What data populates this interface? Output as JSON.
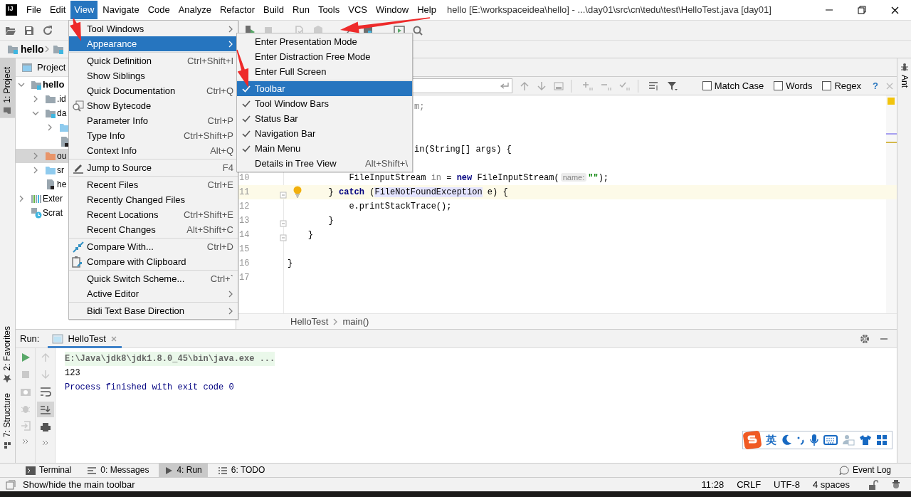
{
  "window": {
    "logo": "IJ",
    "title": "hello [E:\\workspaceidea\\hello] - ...\\day01\\src\\cn\\tedu\\test\\HelloTest.java [day01]"
  },
  "menu_bar": [
    {
      "label": "File",
      "selected": false
    },
    {
      "label": "Edit",
      "selected": false
    },
    {
      "label": "View",
      "selected": true
    },
    {
      "label": "Navigate",
      "selected": false
    },
    {
      "label": "Code",
      "selected": false
    },
    {
      "label": "Analyze",
      "selected": false
    },
    {
      "label": "Refactor",
      "selected": false
    },
    {
      "label": "Build",
      "selected": false
    },
    {
      "label": "Run",
      "selected": false
    },
    {
      "label": "Tools",
      "selected": false
    },
    {
      "label": "VCS",
      "selected": false
    },
    {
      "label": "Window",
      "selected": false
    },
    {
      "label": "Help",
      "selected": false
    }
  ],
  "navigation_bar": [
    {
      "label": "hello",
      "kind": "module"
    },
    {
      "kind": "module"
    }
  ],
  "left_tool_tabs": [
    {
      "label": "1: Project",
      "selected": true,
      "kind": "project"
    },
    {
      "label": "2: Favorites",
      "selected": false,
      "kind": "favorites"
    },
    {
      "label": "7: Structure",
      "selected": false,
      "kind": "structure"
    }
  ],
  "right_tool_tabs": [
    {
      "label": "Ant",
      "selected": false
    }
  ],
  "project_panel": {
    "title": "Project",
    "tree": [
      {
        "label": "hello",
        "kind": "module",
        "expanded": true,
        "selected": false,
        "children": [
          {
            "label": ".id",
            "kind": "folder",
            "expanded": false,
            "selected": false
          },
          {
            "label": "da",
            "kind": "module",
            "expanded": true,
            "selected": false,
            "children": [
              {
                "kind": "source-folder",
                "expanded": false,
                "selected": false
              },
              {
                "kind": "file",
                "selected": false
              }
            ]
          },
          {
            "label": "ou",
            "kind": "output-folder",
            "expanded": false,
            "selected": true
          },
          {
            "label": "sr",
            "kind": "source-folder",
            "expanded": false,
            "selected": false
          },
          {
            "label": "he",
            "kind": "file",
            "selected": false
          }
        ]
      },
      {
        "label": "Exter",
        "kind": "libraries",
        "expanded": false,
        "selected": false
      },
      {
        "label": "Scrat",
        "kind": "scratches",
        "selected": false
      }
    ]
  },
  "editor": {
    "find_bar": {
      "options": [
        {
          "label": "Match Case",
          "checked": false
        },
        {
          "label": "Words",
          "checked": false
        },
        {
          "label": "Regex",
          "checked": false
        }
      ],
      "help": "?"
    },
    "lines": [
      {
        "kind": "partial",
        "tokens": [
          {
            "text": "m;",
            "kind": "unused"
          }
        ]
      },
      {
        "kind": "covered"
      },
      {
        "kind": "covered"
      },
      {
        "kind": "partial",
        "tokens": [
          {
            "text": "in(String[] args) {",
            "kind": "plain"
          }
        ]
      },
      {
        "kind": "covered"
      },
      {
        "kind": "code",
        "number": "10",
        "current": false,
        "bulb": false,
        "fold": false,
        "tokens": [
          {
            "text": "            FileInputStream ",
            "kind": "plain"
          },
          {
            "text": "in",
            "kind": "unused"
          },
          {
            "text": " = ",
            "kind": "plain"
          },
          {
            "text": "new",
            "kind": "keyword"
          },
          {
            "text": " FileInputStream(",
            "kind": "plain"
          },
          {
            "text": "name:",
            "kind": "hint"
          },
          {
            "text": "\"\"",
            "kind": "string"
          },
          {
            "text": ");",
            "kind": "plain"
          }
        ]
      },
      {
        "kind": "code",
        "number": "11",
        "current": true,
        "bulb": true,
        "fold": true,
        "tokens": [
          {
            "text": "        } ",
            "kind": "plain"
          },
          {
            "text": "catch",
            "kind": "keyword"
          },
          {
            "text": " (",
            "kind": "plain"
          },
          {
            "text": "FileNotFoundException",
            "kind": "highlight"
          },
          {
            "text": " e) {",
            "kind": "plain"
          }
        ]
      },
      {
        "kind": "code",
        "number": "12",
        "current": false,
        "bulb": false,
        "fold": false,
        "tokens": [
          {
            "text": "            e.printStackTrace();",
            "kind": "plain"
          }
        ]
      },
      {
        "kind": "code",
        "number": "13",
        "current": false,
        "bulb": false,
        "fold": true,
        "tokens": [
          {
            "text": "        }",
            "kind": "plain"
          }
        ]
      },
      {
        "kind": "code",
        "number": "14",
        "current": false,
        "bulb": false,
        "fold": true,
        "tokens": [
          {
            "text": "    }",
            "kind": "plain"
          }
        ]
      },
      {
        "kind": "code",
        "number": "15",
        "current": false,
        "bulb": false,
        "fold": false
      },
      {
        "kind": "code",
        "number": "16",
        "current": false,
        "bulb": false,
        "fold": false,
        "tokens": [
          {
            "text": "}",
            "kind": "plain"
          }
        ]
      },
      {
        "kind": "code",
        "number": "17",
        "current": false,
        "bulb": false,
        "fold": false
      }
    ],
    "breadcrumbs": [
      "HelloTest",
      "main()"
    ]
  },
  "run_panel": {
    "label": "Run:",
    "tabs": [
      {
        "label": "HelloTest",
        "selected": true
      }
    ],
    "console": [
      {
        "kind": "command",
        "text": "E:\\Java\\jdk8\\jdk1.8.0_45\\bin\\java.exe ..."
      },
      {
        "kind": "output",
        "text": "123"
      },
      {
        "kind": "system",
        "text": "Process finished with exit code 0"
      }
    ]
  },
  "ime_bar": {
    "mode": "英"
  },
  "tool_window_bar": {
    "tabs": [
      {
        "label": "Terminal",
        "kind": "terminal",
        "selected": false
      },
      {
        "label": "0: Messages",
        "kind": "messages",
        "selected": false
      },
      {
        "label": "4: Run",
        "kind": "run",
        "selected": true
      },
      {
        "label": "6: TODO",
        "kind": "todo",
        "selected": false
      }
    ],
    "event_log": "Event Log"
  },
  "status_bar": {
    "message": "Show/hide the main toolbar",
    "items": [
      "11:28",
      "CRLF",
      "UTF-8",
      "4 spaces"
    ]
  },
  "view_menu": {
    "groups": [
      [
        {
          "label": "Tool Windows",
          "submenu": true,
          "selected": false
        },
        {
          "label": "Appearance",
          "submenu": true,
          "selected": true
        }
      ],
      [
        {
          "label": "Quick Definition",
          "shortcut": "Ctrl+Shift+I",
          "selected": false
        },
        {
          "label": "Show Siblings",
          "selected": false
        },
        {
          "label": "Quick Documentation",
          "shortcut": "Ctrl+Q",
          "selected": false
        },
        {
          "label": "Show Bytecode",
          "kind": "bytecode",
          "selected": false
        },
        {
          "label": "Parameter Info",
          "shortcut": "Ctrl+P",
          "selected": false
        },
        {
          "label": "Type Info",
          "shortcut": "Ctrl+Shift+P",
          "selected": false
        },
        {
          "label": "Context Info",
          "shortcut": "Alt+Q",
          "selected": false
        }
      ],
      [
        {
          "label": "Jump to Source",
          "kind": "pencil",
          "shortcut": "F4",
          "selected": false
        }
      ],
      [
        {
          "label": "Recent Files",
          "shortcut": "Ctrl+E",
          "selected": false
        },
        {
          "label": "Recently Changed Files",
          "selected": false
        },
        {
          "label": "Recent Locations",
          "shortcut": "Ctrl+Shift+E",
          "selected": false
        },
        {
          "label": "Recent Changes",
          "shortcut": "Alt+Shift+C",
          "selected": false
        }
      ],
      [
        {
          "label": "Compare With...",
          "kind": "compare",
          "shortcut": "Ctrl+D",
          "selected": false
        },
        {
          "label": "Compare with Clipboard",
          "kind": "clipboard",
          "selected": false
        }
      ],
      [
        {
          "label": "Quick Switch Scheme...",
          "shortcut": "Ctrl+`",
          "selected": false
        },
        {
          "label": "Active Editor",
          "submenu": true,
          "selected": false
        }
      ],
      [
        {
          "label": "Bidi Text Base Direction",
          "submenu": true,
          "selected": false
        }
      ]
    ]
  },
  "appearance_submenu": {
    "groups": [
      [
        {
          "label": "Enter Presentation Mode",
          "checked": false,
          "selected": false
        },
        {
          "label": "Enter Distraction Free Mode",
          "checked": false,
          "selected": false
        },
        {
          "label": "Enter Full Screen",
          "checked": false,
          "selected": false
        }
      ],
      [
        {
          "label": "Toolbar",
          "checked": true,
          "selected": true
        },
        {
          "label": "Tool Window Bars",
          "checked": true,
          "selected": false
        },
        {
          "label": "Status Bar",
          "checked": true,
          "selected": false
        },
        {
          "label": "Navigation Bar",
          "checked": true,
          "selected": false
        },
        {
          "label": "Main Menu",
          "checked": true,
          "selected": false
        },
        {
          "label": "Details in Tree View",
          "checked": false,
          "shortcut": "Alt+Shift+\\",
          "selected": false
        }
      ]
    ]
  }
}
